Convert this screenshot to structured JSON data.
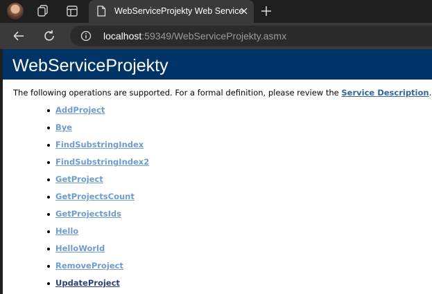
{
  "browser": {
    "tab": {
      "title": "WebServiceProjekty Web Service"
    },
    "address": {
      "host": "localhost",
      "rest": ":59349/WebServiceProjekty.asmx"
    }
  },
  "page": {
    "heading": "WebServiceProjekty",
    "intro_prefix": "The following operations are supported. For a formal definition, please review the ",
    "intro_link": "Service Description",
    "intro_suffix": ".",
    "operations": [
      "AddProject",
      "Bye",
      "FindSubstringIndex",
      "FindSubstringIndex2",
      "GetProject",
      "GetProjectsCount",
      "GetProjectsIds",
      "Hello",
      "HelloWorld",
      "RemoveProject",
      "UpdateProject"
    ]
  },
  "colors": {
    "heading_bg": "#003366",
    "link": "#6e9ccf",
    "visited_link": "#2c3e78",
    "description_link": "#336699"
  }
}
